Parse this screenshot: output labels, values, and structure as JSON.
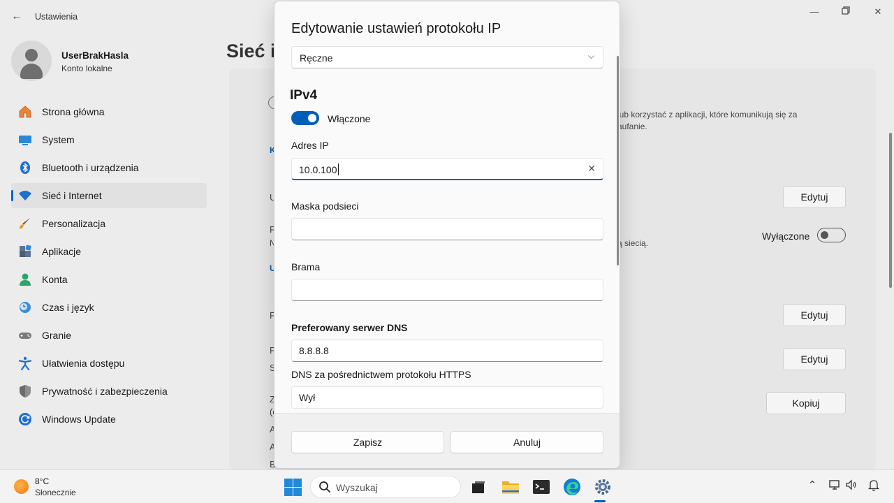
{
  "window": {
    "title": "Ustawienia",
    "back_icon": "back-arrow-icon",
    "controls": [
      "minimize-icon",
      "restore-icon",
      "close-icon"
    ]
  },
  "user": {
    "name": "UserBrakHasla",
    "account_type": "Konto lokalne"
  },
  "sidebar": {
    "items": [
      {
        "label": "Strona główna",
        "icon": "home-icon"
      },
      {
        "label": "System",
        "icon": "system-icon"
      },
      {
        "label": "Bluetooth i urządzenia",
        "icon": "bluetooth-icon"
      },
      {
        "label": "Sieć i Internet",
        "icon": "wifi-icon",
        "active": true
      },
      {
        "label": "Personalizacja",
        "icon": "brush-icon"
      },
      {
        "label": "Aplikacje",
        "icon": "apps-icon"
      },
      {
        "label": "Konta",
        "icon": "account-icon"
      },
      {
        "label": "Czas i język",
        "icon": "clock-globe-icon"
      },
      {
        "label": "Granie",
        "icon": "gamepad-icon"
      },
      {
        "label": "Ułatwienia dostępu",
        "icon": "accessibility-icon"
      },
      {
        "label": "Prywatność i zabezpieczenia",
        "icon": "shield-icon"
      },
      {
        "label": "Windows Update",
        "icon": "update-icon"
      }
    ]
  },
  "page": {
    "title": "Sieć i",
    "background_text": {
      "line1": "lub korzystać z aplikacji, które komunikują się za",
      "line2": "aufanie.",
      "line3": "ą siecią.",
      "metered_toggle_label": "Wyłączone",
      "partial_letters": [
        "K",
        "U",
        "P",
        "N",
        "U",
        "P",
        "P",
        "S",
        "Z",
        "(c",
        "A",
        "A",
        "B"
      ]
    },
    "buttons": {
      "edit1": "Edytuj",
      "edit2": "Edytuj",
      "edit3": "Edytuj",
      "copy": "Kopiuj"
    }
  },
  "dialog": {
    "title": "Edytowanie ustawień protokołu IP",
    "mode": {
      "selected": "Ręczne"
    },
    "ipv4": {
      "heading": "IPv4",
      "toggle_label": "Włączone",
      "toggle_on": true,
      "ip_label": "Adres IP",
      "ip_value": "10.0.100",
      "subnet_label": "Maska podsieci",
      "subnet_value": "",
      "gateway_label": "Brama",
      "gateway_value": "",
      "dns_label": "Preferowany serwer DNS",
      "dns_value": "8.8.8.8",
      "doh_label": "DNS za pośrednictwem protokołu HTTPS",
      "doh_value": "Wył"
    },
    "save_label": "Zapisz",
    "cancel_label": "Anuluj"
  },
  "taskbar": {
    "weather": {
      "temp": "8°C",
      "desc": "Słonecznie",
      "icon": "sun-icon"
    },
    "search_placeholder": "Wyszukaj",
    "apps": [
      "start-icon",
      "search-icon",
      "task-view-icon",
      "file-explorer-icon",
      "terminal-icon",
      "edge-icon",
      "settings-icon"
    ],
    "tray": [
      "chevron-up-icon",
      "network-icon",
      "volume-icon",
      "notification-bell-icon"
    ]
  },
  "colors": {
    "accent": "#005fb8",
    "window_bg": "#ececec",
    "dialog_bg": "#fafafa"
  }
}
